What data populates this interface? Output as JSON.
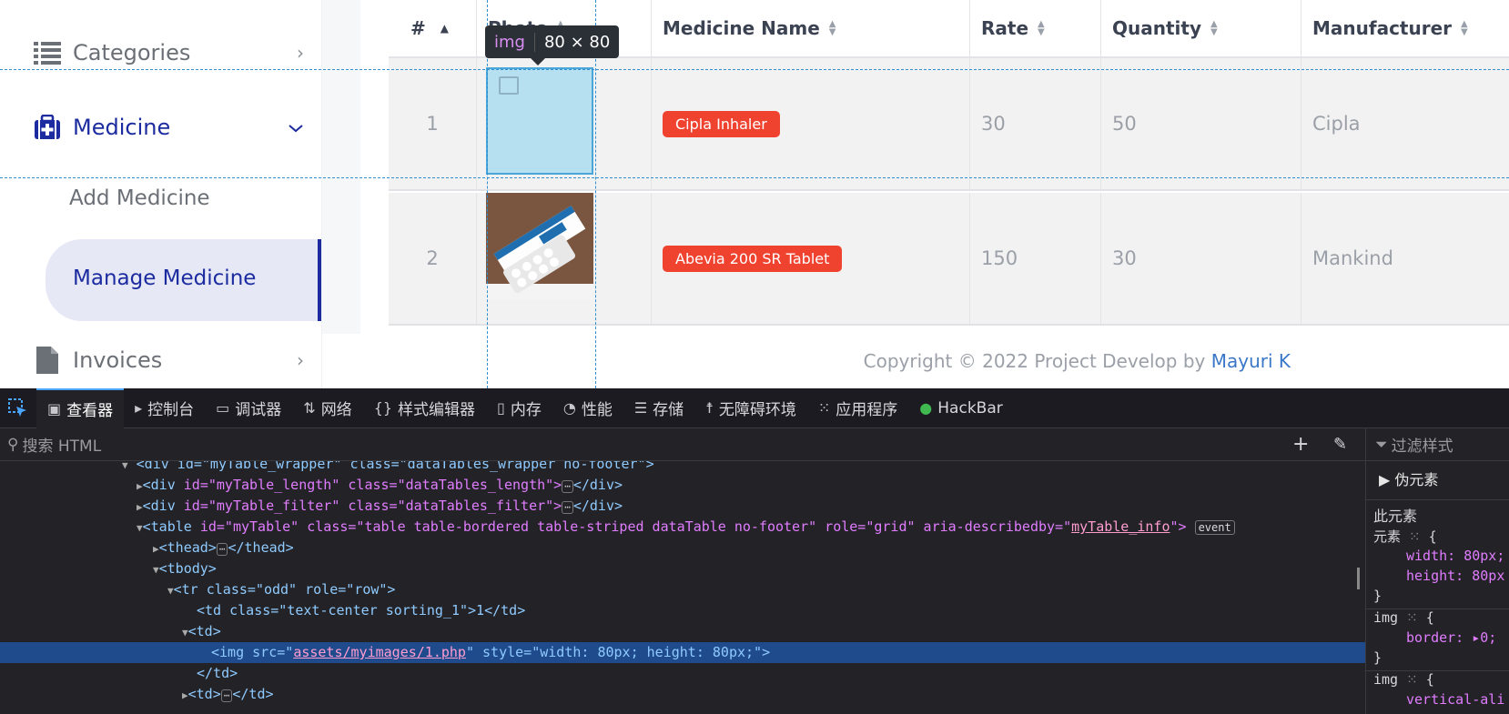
{
  "sidebar": {
    "categories": "Categories",
    "medicine": "Medicine",
    "add_medicine": "Add Medicine",
    "manage_medicine": "Manage Medicine",
    "invoices": "Invoices",
    "chevron_right": "›",
    "chevron_down": "⌄"
  },
  "table": {
    "headers": {
      "num": "#",
      "photo": "Photo",
      "name": "Medicine Name",
      "rate": "Rate",
      "quantity": "Quantity",
      "manufacturer": "Manufacturer"
    },
    "rows": [
      {
        "num": "1",
        "name": "Cipla Inhaler",
        "rate": "30",
        "quantity": "50",
        "manufacturer": "Cipla"
      },
      {
        "num": "2",
        "name": "Abevia 200 SR Tablet",
        "rate": "150",
        "quantity": "30",
        "manufacturer": "Mankind"
      }
    ]
  },
  "tooltip": {
    "tag": "img",
    "size": "80 × 80"
  },
  "footer": {
    "text": "Copyright © 2022 Project Develop by ",
    "author": "Mayuri K"
  },
  "devtools": {
    "tabs": {
      "inspector": "查看器",
      "console": "控制台",
      "debugger": "调试器",
      "network": "网络",
      "style_editor": "样式编辑器",
      "memory": "内存",
      "performance": "性能",
      "storage": "存储",
      "accessibility": "无障碍环境",
      "application": "应用程序",
      "hackbar": "HackBar"
    },
    "search_placeholder": "搜索 HTML",
    "filter_styles": "过滤样式",
    "pseudo_elements": "伪元素",
    "this_element": "此元素",
    "tree": {
      "l0": "<div id=\"myTable_wrapper\" class=\"dataTables_wrapper no-footer\">",
      "l1_tag": "<div ",
      "l1": "id=\"myTable_length\" class=\"dataTables_length\">",
      "l2": "id=\"myTable_filter\" class=\"dataTables_filter\">",
      "l3_a": "id=\"myTable\" class=\"table table-bordered table-striped dataTable no-footer\" role=\"grid\" aria-describedby=\"",
      "l3_link": "myTable_info",
      "event": "event",
      "thead": "<thead>",
      "thead_close": "</thead>",
      "tbody": "<tbody>",
      "tr": "<tr class=\"odd\" role=\"row\">",
      "td1": "<td class=\"text-center sorting_1\">1</td>",
      "td_open": "<td>",
      "img_a": "<img src=\"",
      "img_link": "assets/myimages/1.php",
      "img_b": "\" style=\"width: 80px; height: 80px;\">",
      "td_close": "</td>",
      "td_collapsed": "<td>",
      "td_collapsed_close": "</td>",
      "div_close": "</div>",
      "ellipsis": "⋯"
    },
    "rules": {
      "element": "元素",
      "width": "width: 80px;",
      "height": "height: 80px",
      "img1": "img",
      "border": "border: ▸0;",
      "img2": "img",
      "vertical": "vertical-ali"
    }
  }
}
